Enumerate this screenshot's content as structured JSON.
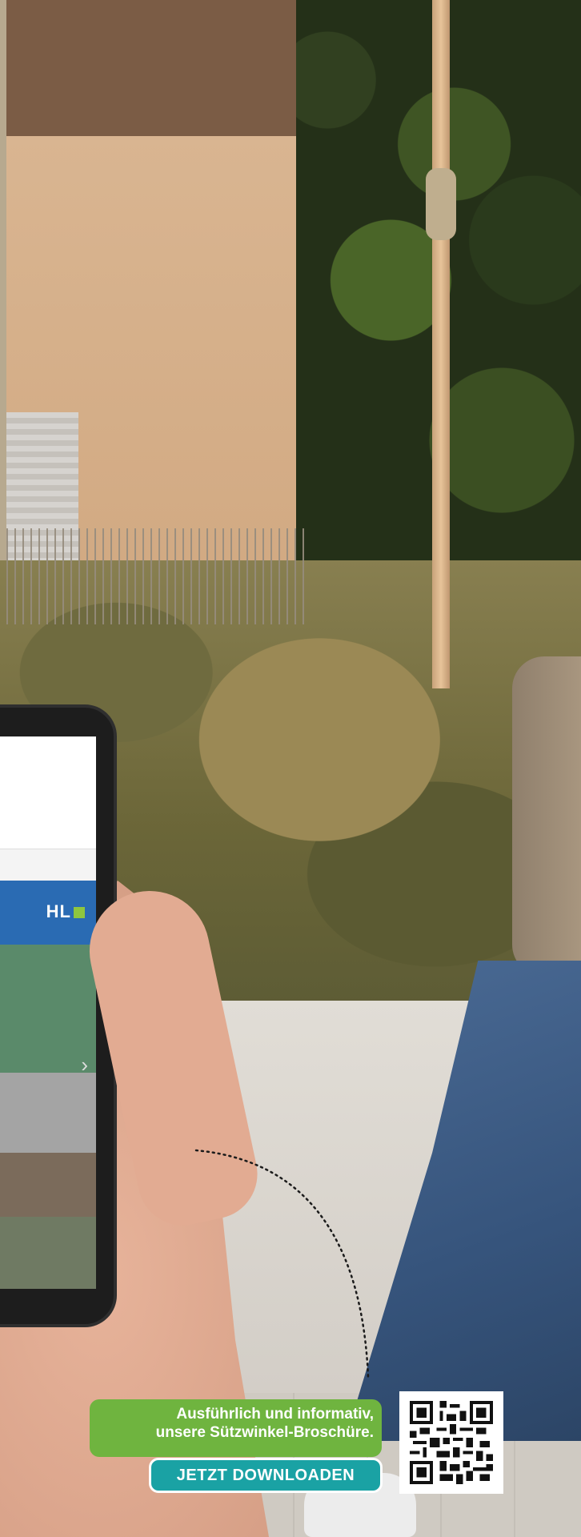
{
  "promo": {
    "line1": "Ausführlich und informativ,",
    "line2": "unsere Sützwinkel-Broschüre.",
    "button_label": "JETZT DOWNLOADEN"
  },
  "phone_screen": {
    "logo_text": "HL"
  },
  "colors": {
    "cta_green": "#6fb43f",
    "cta_teal": "#1aa2a4",
    "logo_green": "#8ec63f"
  }
}
